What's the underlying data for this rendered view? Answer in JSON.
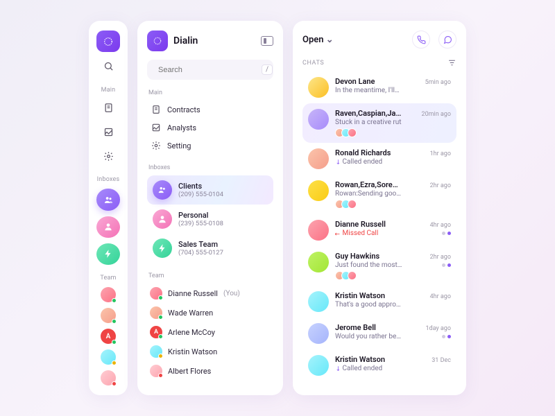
{
  "app": {
    "name": "Dialin"
  },
  "search": {
    "placeholder": "Search",
    "kbd": "/"
  },
  "sections": {
    "main": "Main",
    "inboxes": "Inboxes",
    "team": "Team"
  },
  "nav_main": [
    {
      "label": "Contracts"
    },
    {
      "label": "Analysts"
    },
    {
      "label": "Setting"
    }
  ],
  "inboxes": [
    {
      "label": "Clients",
      "phone": "(209) 555-0104",
      "style": "ib-purple",
      "active": true
    },
    {
      "label": "Personal",
      "phone": "(239) 555-0108",
      "style": "ib-pink"
    },
    {
      "label": "Sales Team",
      "phone": "(704) 555-0127",
      "style": "ib-green"
    }
  ],
  "team": [
    {
      "name": "Dianne Russell",
      "you": "(You)",
      "status": "green",
      "av": "g5"
    },
    {
      "name": "Wade Warren",
      "status": "green",
      "av": "g3"
    },
    {
      "name": "Arlene McCoy",
      "status": "green",
      "av": "gA",
      "initial": "A"
    },
    {
      "name": "Kristin Watson",
      "status": "yellow",
      "av": "g6"
    },
    {
      "name": "Albert Flores",
      "status": "red",
      "av": "g8"
    }
  ],
  "main": {
    "title": "Open",
    "chats_label": "CHATS"
  },
  "chats": [
    {
      "name": "Devon Lane",
      "sub": "In the meantime, I'll…",
      "time": "5min ago",
      "av": "g1"
    },
    {
      "name": "Raven,Caspian,Ja…",
      "sub": "Stuck in a creative rut",
      "time": "20min ago",
      "av": "g2",
      "active": true,
      "group": true
    },
    {
      "name": "Ronald Richards",
      "sub": "Called ended",
      "time": "1hr ago",
      "av": "g3",
      "call": "in"
    },
    {
      "name": "Rowan,Ezra,Sore…",
      "sub": "Rowan:Sending goo…",
      "time": "2hr ago",
      "av": "g4",
      "group": true
    },
    {
      "name": "Dianne Russell",
      "sub": "Missed Call",
      "time": "4hr ago",
      "av": "g5",
      "call": "missed",
      "pip": true
    },
    {
      "name": "Guy Hawkins",
      "sub": "Just found the most…",
      "time": "2hr ago",
      "av": "g7",
      "group": true,
      "pip": true
    },
    {
      "name": "Kristin Watson",
      "sub": "That's a good appro…",
      "time": "4hr ago",
      "av": "g6"
    },
    {
      "name": "Jerome Bell",
      "sub": "Would you rather be…",
      "time": "1day ago",
      "av": "g9",
      "pip": true
    },
    {
      "name": "Kristin Watson",
      "sub": "Called ended",
      "time": "31 Dec",
      "av": "g6",
      "call": "in"
    }
  ]
}
